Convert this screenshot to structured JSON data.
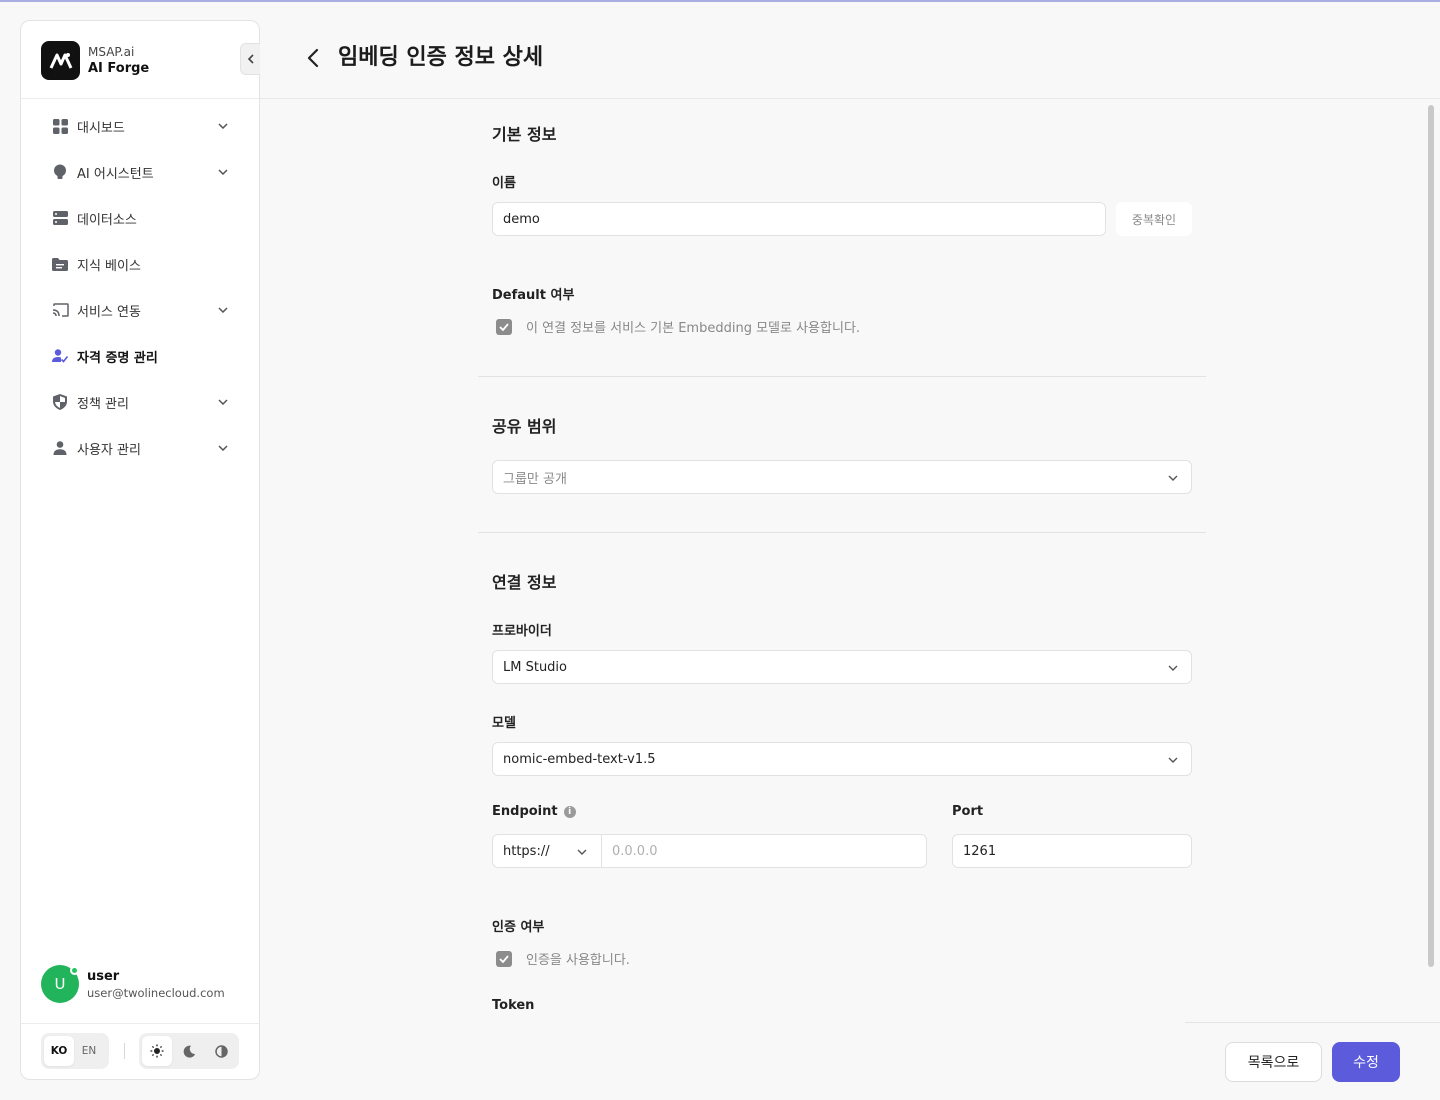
{
  "brand": {
    "sub": "MSAP.ai",
    "name": "AI Forge"
  },
  "sidebar": {
    "items": [
      {
        "label": "대시보드",
        "icon": "dashboard-icon",
        "expandable": true
      },
      {
        "label": "AI 어시스턴트",
        "icon": "lightbulb-icon",
        "expandable": true
      },
      {
        "label": "데이터소스",
        "icon": "database-icon",
        "expandable": false
      },
      {
        "label": "지식 베이스",
        "icon": "folder-icon",
        "expandable": false
      },
      {
        "label": "서비스 연동",
        "icon": "cast-icon",
        "expandable": true
      },
      {
        "label": "자격 증명 관리",
        "icon": "user-check-icon",
        "expandable": false,
        "active": true
      },
      {
        "label": "정책 관리",
        "icon": "shield-icon",
        "expandable": true
      },
      {
        "label": "사용자 관리",
        "icon": "person-icon",
        "expandable": true
      }
    ]
  },
  "user": {
    "initial": "U",
    "name": "user",
    "email": "user@twolinecloud.com"
  },
  "lang": {
    "ko": "KO",
    "en": "EN",
    "selected": "KO"
  },
  "theme": {
    "selected": "light",
    "options": [
      "sun-icon",
      "moon-icon",
      "contrast-icon"
    ]
  },
  "header": {
    "title": "임베딩 인증 정보 상세"
  },
  "basic": {
    "title": "기본 정보",
    "name_label": "이름",
    "name_value": "demo",
    "dup_check": "중복확인",
    "default_label": "Default 여부",
    "default_checkbox_text": "이 연결 정보를 서비스 기본 Embedding 모델로 사용합니다."
  },
  "share": {
    "title": "공유 범위",
    "value": "그룹만 공개"
  },
  "connection": {
    "title": "연결 정보",
    "provider_label": "프로바이더",
    "provider_value": "LM Studio",
    "model_label": "모델",
    "model_value": "nomic-embed-text-v1.5",
    "endpoint_label": "Endpoint",
    "endpoint_protocol": "https://",
    "endpoint_placeholder": "0.0.0.0",
    "port_label": "Port",
    "port_value": "1261",
    "auth_label": "인증 여부",
    "auth_checkbox_text": "인증을 사용합니다.",
    "token_label": "Token"
  },
  "footer": {
    "list_label": "목록으로",
    "edit_label": "수정"
  },
  "colors": {
    "accent": "#5b5bdc",
    "avatar": "#22b45a"
  }
}
